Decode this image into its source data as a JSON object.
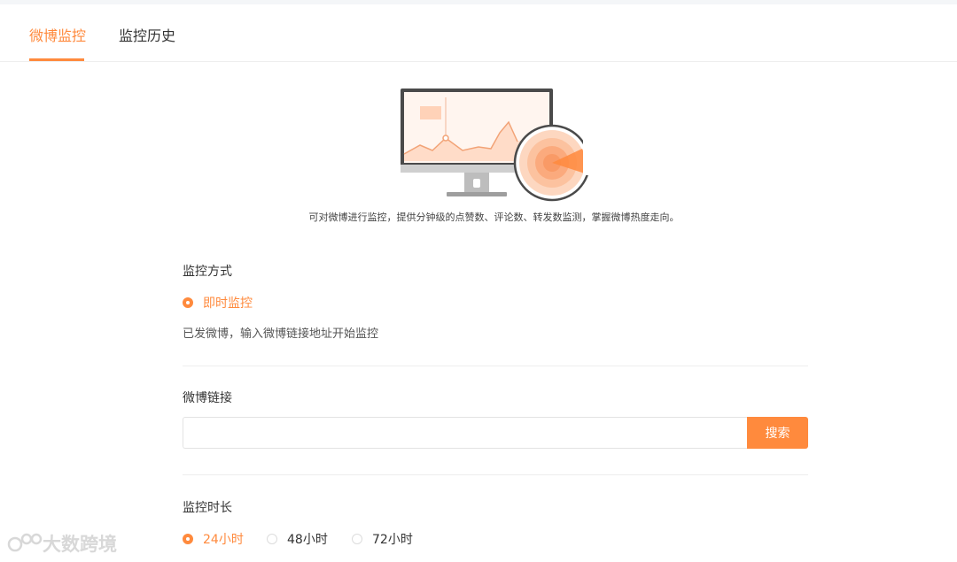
{
  "tabs": [
    {
      "label": "微博监控",
      "active": true
    },
    {
      "label": "监控历史",
      "active": false
    }
  ],
  "description": "可对微博进行监控，提供分钟级的点赞数、评论数、转发数监测，掌握微博热度走向。",
  "mode_section": {
    "title": "监控方式",
    "option": {
      "label": "即时监控",
      "checked": true
    },
    "hint": "已发微博，输入微博链接地址开始监控"
  },
  "link_section": {
    "title": "微博链接",
    "input_value": "",
    "search_label": "搜索"
  },
  "duration_section": {
    "title": "监控时长",
    "options": [
      {
        "label": "24小时",
        "checked": true
      },
      {
        "label": "48小时",
        "checked": false
      },
      {
        "label": "72小时",
        "checked": false
      }
    ]
  },
  "watermark": "大数跨境",
  "colors": {
    "accent": "#ff8a3d",
    "divider": "#eeeeee",
    "monitor_frame": "#4a4a4a"
  },
  "icons": {
    "illustration": "monitor-radar-illustration",
    "watermark_logo": "logo-icon"
  }
}
